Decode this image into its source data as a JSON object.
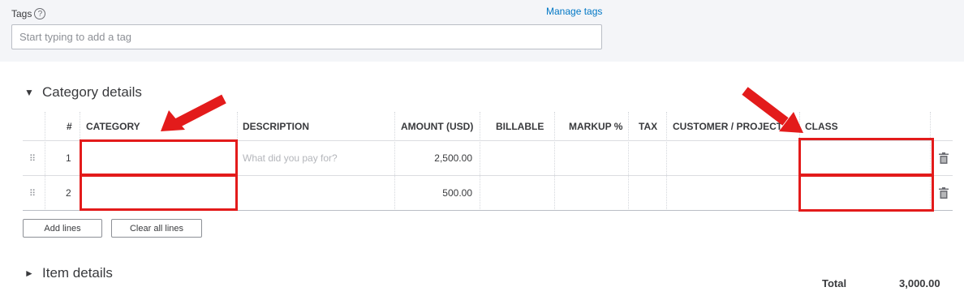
{
  "tags": {
    "label": "Tags",
    "help_icon": "?",
    "manage_link": "Manage tags",
    "placeholder": "Start typing to add a tag"
  },
  "category_section": {
    "title": "Category details",
    "toggle_icon": "▼"
  },
  "item_section": {
    "title": "Item details",
    "toggle_icon": "►"
  },
  "table": {
    "columns": {
      "num": "#",
      "category": "CATEGORY",
      "description": "DESCRIPTION",
      "amount": "AMOUNT (USD)",
      "billable": "BILLABLE",
      "markup": "MARKUP %",
      "tax": "TAX",
      "customer": "CUSTOMER / PROJECT",
      "class": "CLASS"
    },
    "rows": [
      {
        "num": "1",
        "category": "",
        "description_placeholder": "What did you pay for?",
        "amount": "2,500.00",
        "class": ""
      },
      {
        "num": "2",
        "category": "",
        "description_placeholder": "",
        "amount": "500.00",
        "class": ""
      }
    ],
    "drag_icon": "⠿"
  },
  "buttons": {
    "add_lines": "Add lines",
    "clear_all": "Clear all lines"
  },
  "total": {
    "label": "Total",
    "value": "3,000.00"
  },
  "annotation_color": "#e31b1b"
}
